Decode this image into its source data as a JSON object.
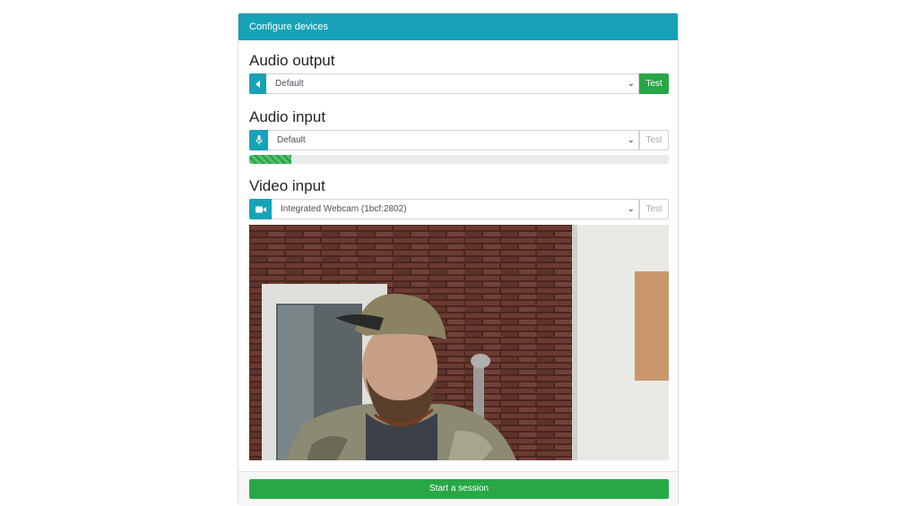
{
  "header": {
    "title": "Configure devices"
  },
  "audio_output": {
    "title": "Audio output",
    "icon": "speaker-icon",
    "selected": "Default",
    "test_label": "Test"
  },
  "audio_input": {
    "title": "Audio input",
    "icon": "microphone-icon",
    "selected": "Default",
    "test_label": "Test",
    "level": 0.1
  },
  "video_input": {
    "title": "Video input",
    "icon": "video-camera-icon",
    "selected": "Integrated Webcam (1bcf:2802)",
    "test_label": "Test"
  },
  "footer": {
    "start_label": "Start a session"
  },
  "colors": {
    "accent": "#17a2b8",
    "success": "#28a745"
  }
}
